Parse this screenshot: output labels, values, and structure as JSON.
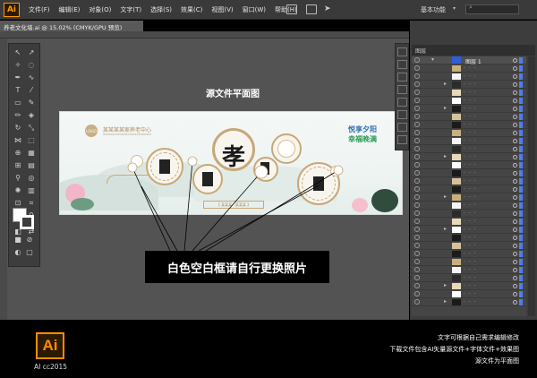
{
  "app": {
    "logo": "Ai",
    "menus": [
      "文件(F)",
      "编辑(E)",
      "对象(O)",
      "文字(T)",
      "选择(S)",
      "效果(C)",
      "视图(V)",
      "窗口(W)",
      "帮助(H)"
    ],
    "workspace": "基本功能",
    "accent_color": "#ff9a00"
  },
  "document": {
    "tab_label": "养老文化墙.ai @ 15.02% (CMYK/GPU 预览)"
  },
  "canvas": {
    "title": "源文件平面图"
  },
  "artwork": {
    "logo_text": "LOGO",
    "org_name": "某某某某家养老中心",
    "org_sub": "Xxxxxxxxxxxxxxxxxxxxxxxxxx",
    "main_char": "孝",
    "slogan_1": "悦享夕阳",
    "slogan_2": "幸福晚满",
    "bottom_banner": "【 某某某 · 某某某 】"
  },
  "callout": {
    "text": "白色空白框请自行更换照片"
  },
  "layers": {
    "panel_title": "图层",
    "top_layer": "图层 1",
    "row_count": 31,
    "layer_color": "#4f7cf0"
  },
  "footer": {
    "badge": "Ai",
    "version": "AI cc2015",
    "notes": [
      "文字可根据自己需求编辑修改",
      "下载文件包含AI矢量源文件+字体文件+效果图",
      "源文件为平面图"
    ]
  }
}
